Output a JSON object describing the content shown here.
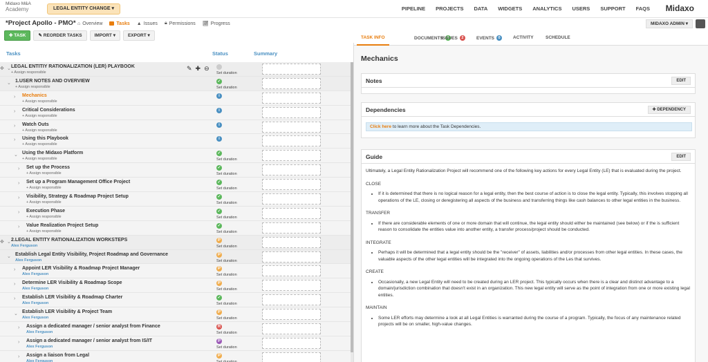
{
  "nav": {
    "logo_line1": "Midaxo M&A",
    "logo_line2": "Academy",
    "context_dropdown": "LEGAL ENTITY CHANGE",
    "links": [
      "PIPELINE",
      "PROJECTS",
      "DATA",
      "WIDGETS",
      "ANALYTICS",
      "USERS",
      "SUPPORT",
      "FAQS"
    ],
    "brand": "Midaxo"
  },
  "project": {
    "title": "*Project Apollo - PMO*",
    "tabs": [
      "Overview",
      "Tasks",
      "Issues",
      "Permissions",
      "Progress"
    ],
    "active_tab": "Tasks",
    "user": "MIDAXO ADMIN"
  },
  "toolbar": {
    "add": "TASK",
    "reorder": "REORDER TASKS",
    "import": "IMPORT",
    "export": "EXPORT"
  },
  "columns": {
    "tasks": "Tasks",
    "status": "Status",
    "summary": "Summary"
  },
  "status_colors": {
    "done": "#5cb85c",
    "info": "#4a90c2",
    "progress": "#f0ad4e",
    "red": "#d9534f",
    "purple": "#9b59b6",
    "none": "#cccccc"
  },
  "tasks": [
    {
      "name": "LEGAL ENTITIY RATIONALIZATION (LER) PLAYBOOK",
      "sub": "+ Assign responsible",
      "level": 0,
      "status": "none",
      "glyph": "",
      "duration": "Set duration"
    },
    {
      "name": "1.USER NOTES AND OVERVIEW",
      "sub": "+ Assign responsible",
      "level": 1,
      "status": "done",
      "glyph": "✓",
      "duration": "Set duration"
    },
    {
      "name": "Mechanics",
      "sub": "+ Assign responsible",
      "level": 2,
      "status": "info",
      "glyph": "i",
      "duration": ""
    },
    {
      "name": "Critical Considerations",
      "sub": "+ Assign responsible",
      "level": 2,
      "status": "info",
      "glyph": "i",
      "duration": ""
    },
    {
      "name": "Watch Outs",
      "sub": "+ Assign responsible",
      "level": 2,
      "status": "info",
      "glyph": "i",
      "duration": ""
    },
    {
      "name": "Using this Playbook",
      "sub": "+ Assign responsible",
      "level": 2,
      "status": "info",
      "glyph": "i",
      "duration": ""
    },
    {
      "name": "Using the Midaxo Platform",
      "sub": "+ Assign responsible",
      "level": 2,
      "status": "done",
      "glyph": "✓",
      "duration": "Set duration"
    },
    {
      "name": "Set up the Process",
      "sub": "+ Assign responsible",
      "level": 3,
      "status": "done",
      "glyph": "✓",
      "duration": "Set duration"
    },
    {
      "name": "Set up a Program Management Office Project",
      "sub": "+ Assign responsible",
      "level": 3,
      "status": "done",
      "glyph": "✓",
      "duration": "Set duration"
    },
    {
      "name": "Visibility, Strategy & Roadmap Project Setup",
      "sub": "+ Assign responsible",
      "level": 3,
      "status": "done",
      "glyph": "✓",
      "duration": "Set duration"
    },
    {
      "name": "Execution Phase",
      "sub": "+ Assign responsible",
      "level": 3,
      "status": "done",
      "glyph": "✓",
      "duration": "Set duration"
    },
    {
      "name": "Value Realization Project Setup",
      "sub": "+ Assign responsible",
      "level": 3,
      "status": "done",
      "glyph": "✓",
      "duration": "Set duration"
    },
    {
      "name": "2.LEGAL ENTITY RATIONALIZATION WORKSTEPS",
      "sub": "Alex Ferguson",
      "level": 0,
      "status": "progress",
      "glyph": "P",
      "duration": "Set duration"
    },
    {
      "name": "Establish Legal Entity Visibility, Project Roadmap and Governance",
      "sub": "Alex Ferguson",
      "level": 1,
      "status": "progress",
      "glyph": "P",
      "duration": "Set duration"
    },
    {
      "name": "Appoint LER Visibility & Roadmap Project Manager",
      "sub": "Alex Ferguson",
      "level": 2,
      "status": "progress",
      "glyph": "P",
      "duration": "Set duration"
    },
    {
      "name": "Determine LER Visibility & Roadmap Scope",
      "sub": "Alex Ferguson",
      "level": 2,
      "status": "progress",
      "glyph": "P",
      "duration": "Set duration"
    },
    {
      "name": "Establish LER Visibility & Roadmap Charter",
      "sub": "Alex Ferguson",
      "level": 2,
      "status": "done",
      "glyph": "✓",
      "duration": "Set duration"
    },
    {
      "name": "Establish LER Visibility & Project Team",
      "sub": "Alex Ferguson",
      "level": 2,
      "status": "progress",
      "glyph": "P",
      "duration": "Set duration"
    },
    {
      "name": "Assign a dedicated manager / senior analyst from Finance",
      "sub": "Alex Ferguson",
      "level": 3,
      "status": "red",
      "glyph": "R",
      "duration": "Set duration"
    },
    {
      "name": "Assign a dedicated manager / senior analyst from IS/IT",
      "sub": "Alex Ferguson",
      "level": 3,
      "status": "purple",
      "glyph": "P",
      "duration": "Set duration"
    },
    {
      "name": "Assign a liaison from Legal",
      "sub": "Alex Ferguson",
      "level": 3,
      "status": "progress",
      "glyph": "P",
      "duration": "Set duration"
    }
  ],
  "detail": {
    "tabs": [
      {
        "label": "TASK INFO",
        "badge": null,
        "badge_color": null
      },
      {
        "label": "DOCUMENTS",
        "badge": "0",
        "badge_color": "#5cb85c"
      },
      {
        "label": "ISSUES",
        "badge": "2",
        "badge_color": "#d9534f"
      },
      {
        "label": "EVENTS",
        "badge": "0",
        "badge_color": "#4a90c2"
      },
      {
        "label": "ACTIVITY",
        "badge": null,
        "badge_color": null
      },
      {
        "label": "SCHEDULE",
        "badge": null,
        "badge_color": null
      }
    ],
    "title": "Mechanics",
    "notes_title": "Notes",
    "edit": "EDIT",
    "dep_title": "Dependencies",
    "dep_button": "DEPENDENCY",
    "dep_link": "Click here",
    "dep_text": " to learn more about the Task Dependencies.",
    "guide_title": "Guide",
    "guide_intro": "Ultimately, a Legal Entity Rationalization Project will recommend one of the following key actions for every Legal Entity (LE) that is evaluated during the project.",
    "sections": [
      {
        "h": "CLOSE",
        "t": "If it is determined that there is no logical reason for a legal entity, then the best course of action is to close the legal entity. Typically, this involves stopping all operations of the LE, closing or deregistering all aspects of the business and transferring things like cash balances to other legal entities in the business."
      },
      {
        "h": "TRANSFER",
        "t": "If there are considerable elements of one or more domain that will continue, the legal entity should either be maintained (see below) or if the is sufficient reason to consolidate the entities value into another entity, a transfer process/project should be conducted."
      },
      {
        "h": "INTEGRATE",
        "t": "Perhaps it will be determined that a legal entity should be the \"receiver\" of assets, liabilities and/or processes from other legal entities. In these cases, the valuable aspects of the other legal entities will be integrated into the ongoing operations of the Les that survives."
      },
      {
        "h": "CREATE",
        "t": "Occasionally, a new Legal Entity will need to be created during an LER project. This typically occurs when there is a clear and distinct advantage to a domain/jurisdiction combination that doesn't exist in an organization. This new legal entity will serve as the point of integration from one or more existing legal entities."
      },
      {
        "h": "MAINTAIN",
        "t": "Some LER efforts may determine a look at all Legal Entities is warranted during the course of a program. Typically, the focus of any maintenance related projects will be on smaller, high-value changes."
      }
    ]
  }
}
